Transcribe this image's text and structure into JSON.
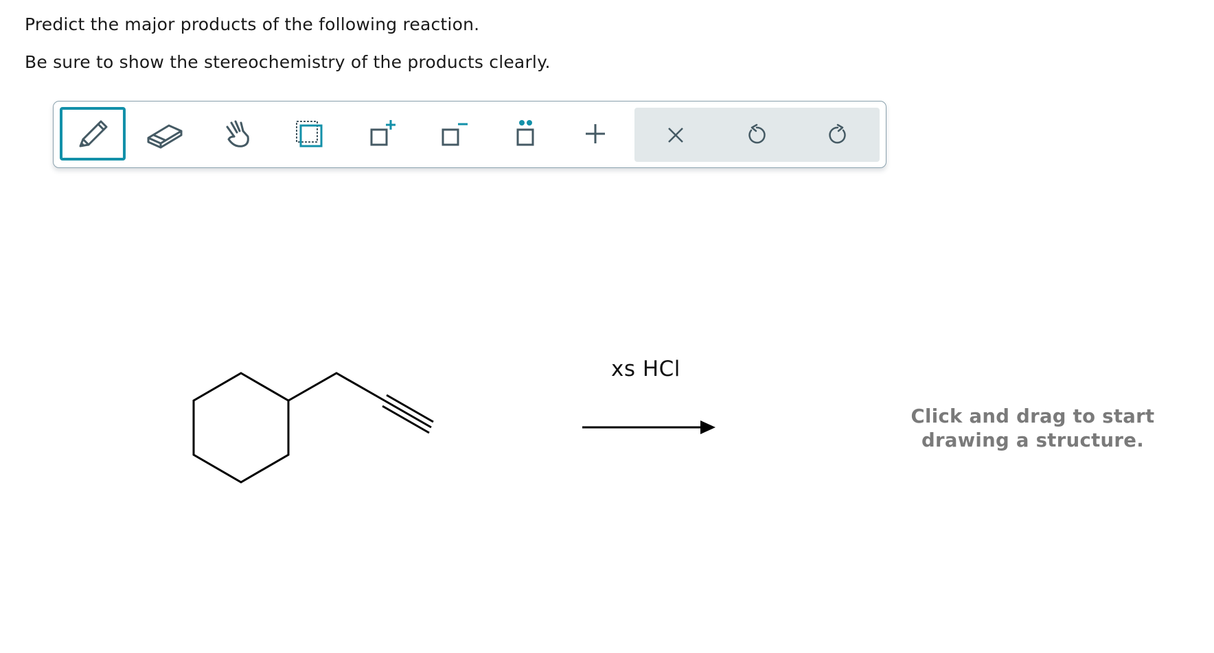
{
  "question": {
    "line1": "Predict the major products of the following reaction.",
    "line2": "Be sure to show the stereochemistry of the products clearly."
  },
  "toolbar": {
    "tools": [
      {
        "icon": "pencil-icon",
        "active": true
      },
      {
        "icon": "eraser-icon",
        "active": false
      },
      {
        "icon": "hand-icon",
        "active": false
      },
      {
        "icon": "select-box-icon",
        "active": false
      },
      {
        "icon": "positive-charge-icon",
        "active": false
      },
      {
        "icon": "negative-charge-icon",
        "active": false
      },
      {
        "icon": "lone-pair-icon",
        "active": false
      },
      {
        "icon": "add-arrow-icon",
        "active": false
      }
    ],
    "actions": [
      {
        "icon": "clear-icon"
      },
      {
        "icon": "undo-icon"
      },
      {
        "icon": "redo-icon"
      }
    ],
    "accent_color": "#1390a9",
    "icon_color": "#455a64"
  },
  "reaction": {
    "reagent": "xs HCl",
    "product_hint_line1": "Click and drag to start",
    "product_hint_line2": "drawing a structure."
  }
}
